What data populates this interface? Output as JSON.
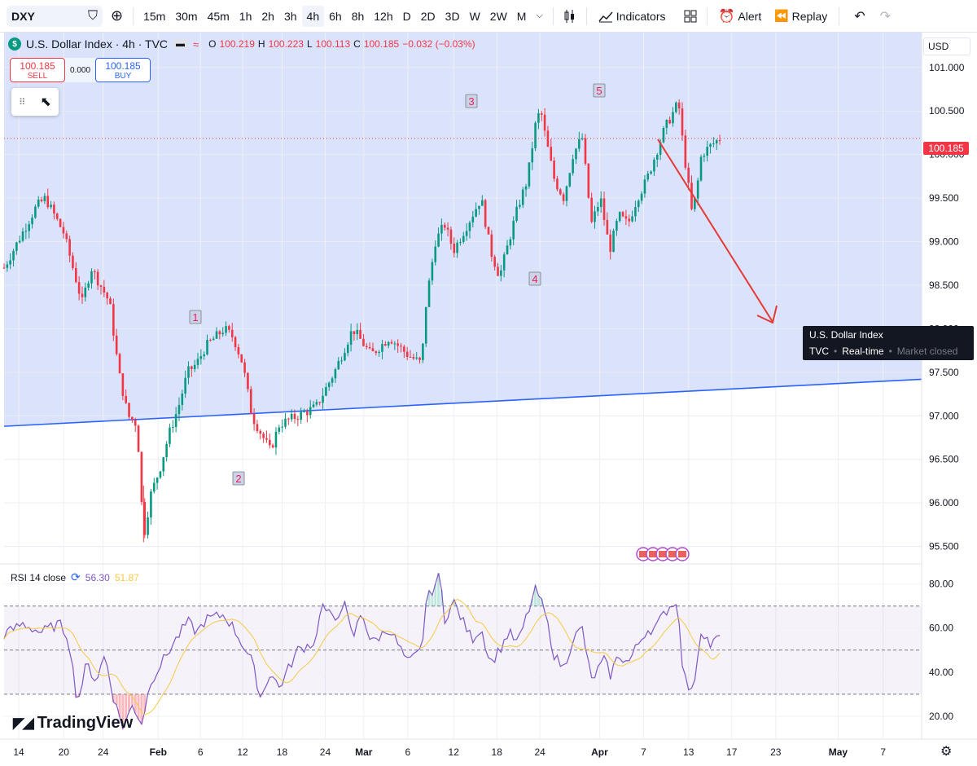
{
  "toolbar": {
    "symbol": "DXY",
    "timeframes": [
      "15m",
      "30m",
      "45m",
      "1h",
      "2h",
      "3h",
      "4h",
      "6h",
      "8h",
      "12h",
      "D",
      "2D",
      "3D",
      "W",
      "2W",
      "M"
    ],
    "active_timeframe": "4h",
    "indicators_label": "Indicators",
    "alert_label": "Alert",
    "replay_label": "Replay"
  },
  "legend": {
    "title": "U.S. Dollar Index · 4h · TVC",
    "open_label": "O",
    "open": "100.219",
    "high_label": "H",
    "high": "100.223",
    "low_label": "L",
    "low": "100.113",
    "close_label": "C",
    "close": "100.185",
    "change": "−0.032 (−0.03%)"
  },
  "trade": {
    "sell_price": "100.185",
    "sell_label": "SELL",
    "spread": "0.000",
    "buy_price": "100.185",
    "buy_label": "BUY"
  },
  "price_axis": {
    "currency": "USD",
    "ticks": [
      "101.000",
      "100.500",
      "100.000",
      "99.500",
      "99.000",
      "98.500",
      "98.000",
      "97.500",
      "97.000",
      "96.500",
      "96.000",
      "95.500"
    ],
    "last_price": "100.185"
  },
  "tooltip": {
    "title": "U.S. Dollar Index",
    "source": "TVC",
    "mode": "Real-time",
    "status": "Market closed"
  },
  "wave_labels": [
    "1",
    "2",
    "3",
    "4",
    "5"
  ],
  "rsi": {
    "label": "RSI 14 close",
    "value": "56.30",
    "ma_value": "51.87",
    "ticks": [
      "80.00",
      "60.00",
      "40.00",
      "20.00"
    ]
  },
  "time_axis": {
    "labels": [
      "14",
      "20",
      "24",
      "Feb",
      "6",
      "12",
      "18",
      "24",
      "Mar",
      "6",
      "12",
      "18",
      "24",
      "Apr",
      "7",
      "13",
      "17",
      "23",
      "May",
      "7"
    ]
  },
  "brand": "TradingView",
  "chart_data": {
    "type": "candlestick",
    "ylim": [
      95.3,
      101.4
    ],
    "last_price": 100.185,
    "trendline": {
      "start": [
        0,
        96.88
      ],
      "end": [
        1,
        97.42
      ]
    },
    "price_path": [
      [
        0.0,
        98.7
      ],
      [
        0.02,
        99.1
      ],
      [
        0.035,
        99.4
      ],
      [
        0.045,
        99.5
      ],
      [
        0.055,
        99.3
      ],
      [
        0.065,
        99.1
      ],
      [
        0.075,
        98.7
      ],
      [
        0.085,
        98.3
      ],
      [
        0.095,
        98.7
      ],
      [
        0.105,
        98.5
      ],
      [
        0.115,
        98.3
      ],
      [
        0.125,
        97.5
      ],
      [
        0.135,
        97.0
      ],
      [
        0.145,
        96.9
      ],
      [
        0.152,
        95.6
      ],
      [
        0.16,
        96.1
      ],
      [
        0.17,
        96.4
      ],
      [
        0.18,
        96.8
      ],
      [
        0.19,
        97.1
      ],
      [
        0.2,
        97.5
      ],
      [
        0.21,
        97.6
      ],
      [
        0.22,
        97.8
      ],
      [
        0.23,
        97.9
      ],
      [
        0.24,
        98.0
      ],
      [
        0.25,
        97.9
      ],
      [
        0.26,
        97.6
      ],
      [
        0.27,
        97.0
      ],
      [
        0.28,
        96.8
      ],
      [
        0.29,
        96.6
      ],
      [
        0.3,
        96.9
      ],
      [
        0.32,
        97.0
      ],
      [
        0.34,
        97.1
      ],
      [
        0.36,
        97.5
      ],
      [
        0.38,
        98.0
      ],
      [
        0.4,
        97.7
      ],
      [
        0.42,
        97.9
      ],
      [
        0.44,
        97.7
      ],
      [
        0.455,
        97.6
      ],
      [
        0.46,
        98.3
      ],
      [
        0.47,
        99.0
      ],
      [
        0.48,
        99.2
      ],
      [
        0.49,
        98.9
      ],
      [
        0.5,
        99.1
      ],
      [
        0.51,
        99.3
      ],
      [
        0.52,
        99.5
      ],
      [
        0.53,
        98.9
      ],
      [
        0.54,
        98.6
      ],
      [
        0.55,
        99.0
      ],
      [
        0.56,
        99.4
      ],
      [
        0.57,
        99.7
      ],
      [
        0.58,
        100.4
      ],
      [
        0.585,
        100.5
      ],
      [
        0.59,
        100.2
      ],
      [
        0.6,
        99.7
      ],
      [
        0.61,
        99.5
      ],
      [
        0.62,
        100.0
      ],
      [
        0.63,
        100.2
      ],
      [
        0.64,
        99.2
      ],
      [
        0.65,
        99.5
      ],
      [
        0.655,
        99.2
      ],
      [
        0.66,
        98.9
      ],
      [
        0.67,
        99.3
      ],
      [
        0.68,
        99.2
      ],
      [
        0.69,
        99.5
      ],
      [
        0.7,
        99.7
      ],
      [
        0.71,
        100.0
      ],
      [
        0.72,
        100.3
      ],
      [
        0.73,
        100.5
      ],
      [
        0.735,
        100.6
      ],
      [
        0.74,
        100.1
      ],
      [
        0.745,
        99.7
      ],
      [
        0.75,
        99.3
      ],
      [
        0.755,
        99.6
      ],
      [
        0.76,
        100.0
      ],
      [
        0.77,
        100.1
      ],
      [
        0.78,
        100.185
      ]
    ],
    "rsi_path": [
      [
        0.0,
        57
      ],
      [
        0.02,
        62
      ],
      [
        0.04,
        58
      ],
      [
        0.06,
        62
      ],
      [
        0.07,
        56
      ],
      [
        0.08,
        26
      ],
      [
        0.09,
        44
      ],
      [
        0.1,
        36
      ],
      [
        0.11,
        48
      ],
      [
        0.12,
        27
      ],
      [
        0.13,
        15
      ],
      [
        0.14,
        25
      ],
      [
        0.15,
        17
      ],
      [
        0.16,
        36
      ],
      [
        0.18,
        50
      ],
      [
        0.2,
        63
      ],
      [
        0.21,
        58
      ],
      [
        0.22,
        64
      ],
      [
        0.24,
        66
      ],
      [
        0.25,
        60
      ],
      [
        0.27,
        45
      ],
      [
        0.28,
        28
      ],
      [
        0.29,
        40
      ],
      [
        0.3,
        33
      ],
      [
        0.32,
        50
      ],
      [
        0.34,
        54
      ],
      [
        0.345,
        71
      ],
      [
        0.36,
        63
      ],
      [
        0.37,
        72
      ],
      [
        0.38,
        55
      ],
      [
        0.39,
        68
      ],
      [
        0.4,
        53
      ],
      [
        0.42,
        60
      ],
      [
        0.44,
        44
      ],
      [
        0.455,
        50
      ],
      [
        0.46,
        72
      ],
      [
        0.475,
        84
      ],
      [
        0.48,
        64
      ],
      [
        0.49,
        72
      ],
      [
        0.5,
        63
      ],
      [
        0.51,
        55
      ],
      [
        0.52,
        60
      ],
      [
        0.53,
        44
      ],
      [
        0.54,
        50
      ],
      [
        0.55,
        58
      ],
      [
        0.56,
        53
      ],
      [
        0.57,
        66
      ],
      [
        0.58,
        78
      ],
      [
        0.59,
        66
      ],
      [
        0.6,
        47
      ],
      [
        0.61,
        42
      ],
      [
        0.62,
        55
      ],
      [
        0.63,
        60
      ],
      [
        0.64,
        36
      ],
      [
        0.65,
        43
      ],
      [
        0.655,
        46
      ],
      [
        0.66,
        38
      ],
      [
        0.67,
        48
      ],
      [
        0.68,
        44
      ],
      [
        0.69,
        52
      ],
      [
        0.7,
        59
      ],
      [
        0.71,
        60
      ],
      [
        0.72,
        67
      ],
      [
        0.73,
        72
      ],
      [
        0.735,
        68
      ],
      [
        0.74,
        40
      ],
      [
        0.745,
        34
      ],
      [
        0.75,
        30
      ],
      [
        0.755,
        45
      ],
      [
        0.76,
        60
      ],
      [
        0.77,
        52
      ],
      [
        0.78,
        56.3
      ]
    ],
    "rsi_levels": [
      70,
      50,
      30
    ],
    "rsi_ylim": [
      10,
      88
    ]
  }
}
